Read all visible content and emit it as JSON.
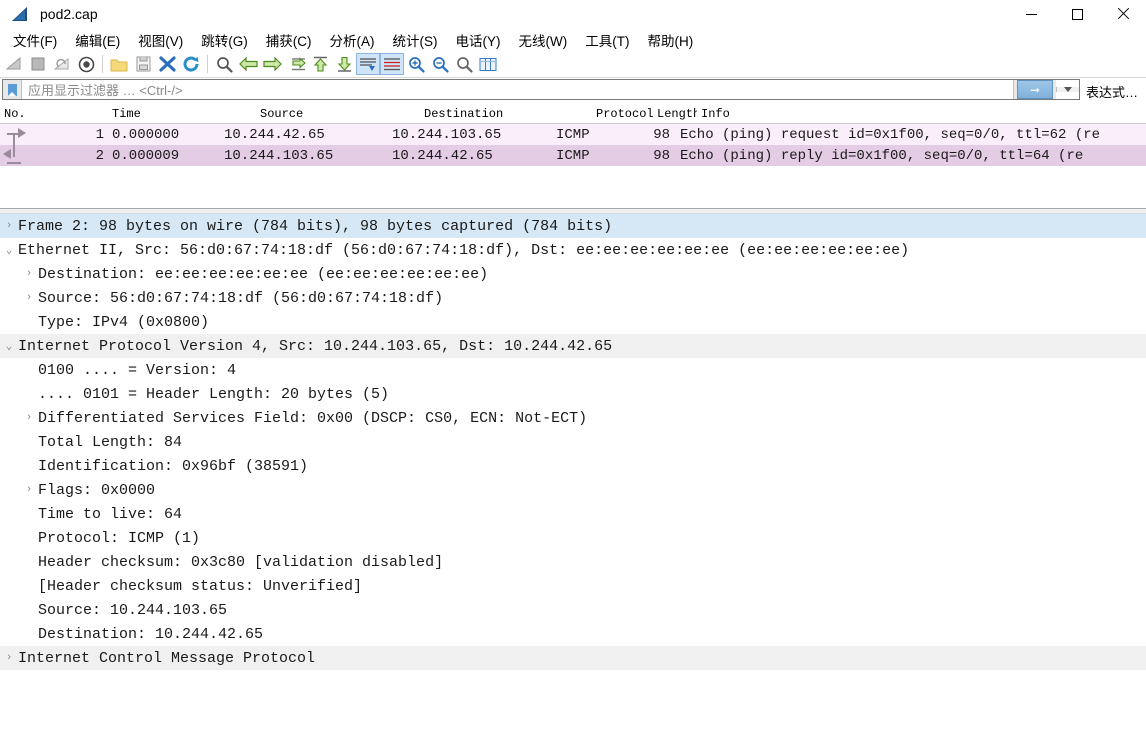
{
  "window": {
    "title": "pod2.cap",
    "icon": "wireshark-fin-icon",
    "minimize_label": "—",
    "maximize_label": "□",
    "close_label": "✕"
  },
  "menu": {
    "items": [
      {
        "label": "文件(F)",
        "name": "menu-file"
      },
      {
        "label": "编辑(E)",
        "name": "menu-edit"
      },
      {
        "label": "视图(V)",
        "name": "menu-view"
      },
      {
        "label": "跳转(G)",
        "name": "menu-go"
      },
      {
        "label": "捕获(C)",
        "name": "menu-capture"
      },
      {
        "label": "分析(A)",
        "name": "menu-analyze"
      },
      {
        "label": "统计(S)",
        "name": "menu-statistics"
      },
      {
        "label": "电话(Y)",
        "name": "menu-telephony"
      },
      {
        "label": "无线(W)",
        "name": "menu-wireless"
      },
      {
        "label": "工具(T)",
        "name": "menu-tools"
      },
      {
        "label": "帮助(H)",
        "name": "menu-help"
      }
    ]
  },
  "toolbar": {
    "buttons": [
      {
        "name": "start-capture-icon",
        "glyph": "shark-fin",
        "state": "disabled"
      },
      {
        "name": "stop-capture-icon",
        "glyph": "stop-square",
        "state": "disabled"
      },
      {
        "name": "restart-capture-icon",
        "glyph": "shark-restart",
        "state": "disabled"
      },
      {
        "name": "capture-options-icon",
        "glyph": "gear-circle",
        "state": "enabled"
      },
      {
        "name": "separator-1",
        "glyph": "separator",
        "state": "static"
      },
      {
        "name": "open-file-icon",
        "glyph": "folder",
        "state": "enabled"
      },
      {
        "name": "save-file-icon",
        "glyph": "floppy",
        "state": "enabled"
      },
      {
        "name": "close-file-icon",
        "glyph": "blue-x",
        "state": "enabled"
      },
      {
        "name": "reload-file-icon",
        "glyph": "reload",
        "state": "enabled"
      },
      {
        "name": "separator-2",
        "glyph": "separator",
        "state": "static"
      },
      {
        "name": "find-packet-icon",
        "glyph": "magnifier",
        "state": "enabled"
      },
      {
        "name": "go-back-icon",
        "glyph": "arrow-left",
        "state": "enabled"
      },
      {
        "name": "go-forward-icon",
        "glyph": "arrow-right",
        "state": "enabled"
      },
      {
        "name": "go-to-packet-icon",
        "glyph": "goto-packet",
        "state": "enabled"
      },
      {
        "name": "go-to-first-icon",
        "glyph": "arrow-up",
        "state": "enabled"
      },
      {
        "name": "go-to-last-icon",
        "glyph": "arrow-down",
        "state": "enabled"
      },
      {
        "name": "auto-scroll-icon",
        "glyph": "autoscroll",
        "state": "toggled"
      },
      {
        "name": "colorize-icon",
        "glyph": "colorize",
        "state": "toggled"
      },
      {
        "name": "zoom-in-icon",
        "glyph": "zoom-in",
        "state": "enabled"
      },
      {
        "name": "zoom-out-icon",
        "glyph": "zoom-out",
        "state": "enabled"
      },
      {
        "name": "zoom-reset-icon",
        "glyph": "zoom-reset",
        "state": "enabled"
      },
      {
        "name": "resize-columns-icon",
        "glyph": "resize-cols",
        "state": "enabled"
      }
    ]
  },
  "filter": {
    "bookmark_icon": "bookmark-icon",
    "placeholder": "应用显示过滤器 … <Ctrl-/>",
    "value": "",
    "apply_icon": "arrow-right-icon",
    "dropdown_icon": "chevron-down-icon",
    "expression_label": "表达式…"
  },
  "packet_list": {
    "columns": [
      "No.",
      "Time",
      "Source",
      "Destination",
      "Protocol",
      "Length",
      "Info"
    ],
    "rows": [
      {
        "no": "1",
        "time": "0.000000",
        "source": "10.244.42.65",
        "destination": "10.244.103.65",
        "protocol": "ICMP",
        "length": "98",
        "info": "Echo (ping) request  id=0x1f00, seq=0/0, ttl=62 (re",
        "direction": "request",
        "bg": "#fbeefb"
      },
      {
        "no": "2",
        "time": "0.000009",
        "source": "10.244.103.65",
        "destination": "10.244.42.65",
        "protocol": "ICMP",
        "length": "98",
        "info": "Echo (ping) reply    id=0x1f00, seq=0/0, ttl=64 (re",
        "direction": "reply",
        "bg": "#e4cde4"
      }
    ]
  },
  "packet_details": {
    "rows": [
      {
        "twisty": "collapsed",
        "indent": 0,
        "selected": true,
        "alt": false,
        "text": "Frame 2: 98 bytes on wire (784 bits), 98 bytes captured (784 bits)"
      },
      {
        "twisty": "expanded",
        "indent": 0,
        "selected": false,
        "alt": false,
        "text": "Ethernet II, Src: 56:d0:67:74:18:df (56:d0:67:74:18:df), Dst: ee:ee:ee:ee:ee:ee (ee:ee:ee:ee:ee:ee)"
      },
      {
        "twisty": "collapsed",
        "indent": 1,
        "selected": false,
        "alt": false,
        "text": "Destination: ee:ee:ee:ee:ee:ee (ee:ee:ee:ee:ee:ee)"
      },
      {
        "twisty": "collapsed",
        "indent": 1,
        "selected": false,
        "alt": false,
        "text": "Source: 56:d0:67:74:18:df (56:d0:67:74:18:df)"
      },
      {
        "twisty": "none",
        "indent": 1,
        "selected": false,
        "alt": false,
        "text": "Type: IPv4 (0x0800)"
      },
      {
        "twisty": "expanded",
        "indent": 0,
        "selected": false,
        "alt": true,
        "text": "Internet Protocol Version 4, Src: 10.244.103.65, Dst: 10.244.42.65"
      },
      {
        "twisty": "none",
        "indent": 1,
        "selected": false,
        "alt": false,
        "text": "0100 .... = Version: 4"
      },
      {
        "twisty": "none",
        "indent": 1,
        "selected": false,
        "alt": false,
        "text": ".... 0101 = Header Length: 20 bytes (5)"
      },
      {
        "twisty": "collapsed",
        "indent": 1,
        "selected": false,
        "alt": false,
        "text": "Differentiated Services Field: 0x00 (DSCP: CS0, ECN: Not-ECT)"
      },
      {
        "twisty": "none",
        "indent": 1,
        "selected": false,
        "alt": false,
        "text": "Total Length: 84"
      },
      {
        "twisty": "none",
        "indent": 1,
        "selected": false,
        "alt": false,
        "text": "Identification: 0x96bf (38591)"
      },
      {
        "twisty": "collapsed",
        "indent": 1,
        "selected": false,
        "alt": false,
        "text": "Flags: 0x0000"
      },
      {
        "twisty": "none",
        "indent": 1,
        "selected": false,
        "alt": false,
        "text": "Time to live: 64"
      },
      {
        "twisty": "none",
        "indent": 1,
        "selected": false,
        "alt": false,
        "text": "Protocol: ICMP (1)"
      },
      {
        "twisty": "none",
        "indent": 1,
        "selected": false,
        "alt": false,
        "text": "Header checksum: 0x3c80 [validation disabled]"
      },
      {
        "twisty": "none",
        "indent": 1,
        "selected": false,
        "alt": false,
        "text": "[Header checksum status: Unverified]"
      },
      {
        "twisty": "none",
        "indent": 1,
        "selected": false,
        "alt": false,
        "text": "Source: 10.244.103.65"
      },
      {
        "twisty": "none",
        "indent": 1,
        "selected": false,
        "alt": false,
        "text": "Destination: 10.244.42.65"
      },
      {
        "twisty": "collapsed",
        "indent": 0,
        "selected": false,
        "alt": true,
        "text": "Internet Control Message Protocol"
      }
    ]
  },
  "colors": {
    "icmp_request_bg": "#fbeefb",
    "icmp_reply_bg": "#e4cde4",
    "selection_bg": "#d6e8f5",
    "alt_row_bg": "#f0f0f0",
    "accent": "#1c4f80"
  }
}
